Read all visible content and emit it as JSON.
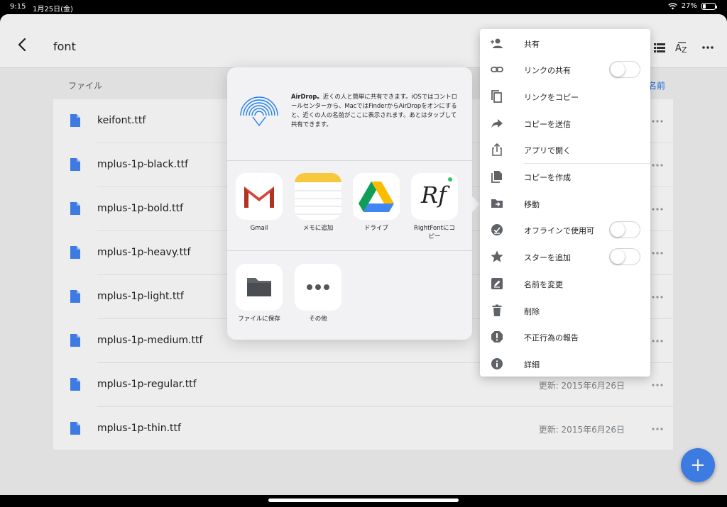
{
  "status": {
    "time": "9:15",
    "date": "1月25日(金)",
    "battery_pct": "27%",
    "battery_level": 0.27
  },
  "appbar": {
    "title": "font"
  },
  "list": {
    "header": "ファイル",
    "sort_label": "名前",
    "files": [
      {
        "name": "keifont.ttf",
        "date": ""
      },
      {
        "name": "mplus-1p-black.ttf",
        "date": ""
      },
      {
        "name": "mplus-1p-bold.ttf",
        "date": ""
      },
      {
        "name": "mplus-1p-heavy.ttf",
        "date": ""
      },
      {
        "name": "mplus-1p-light.ttf",
        "date": ""
      },
      {
        "name": "mplus-1p-medium.ttf",
        "date": ""
      },
      {
        "name": "mplus-1p-regular.ttf",
        "date": "更新: 2015年6月26日"
      },
      {
        "name": "mplus-1p-thin.ttf",
        "date": "更新: 2015年6月26日"
      }
    ]
  },
  "share_sheet": {
    "airdrop_title": "AirDrop。",
    "airdrop_text": "近くの人と簡単に共有できます。iOSではコントロールセンターから、MacではFinderからAirDropをオンにすると、近くの人の名前がここに表示されます。あとはタップして共有できます。",
    "apps": [
      {
        "label": "Gmail",
        "icon": "gmail-icon"
      },
      {
        "label": "メモに追加",
        "icon": "notes-icon"
      },
      {
        "label": "ドライブ",
        "icon": "drive-icon"
      },
      {
        "label": "RightFontにコピー",
        "icon": "rightfont-icon",
        "icon_text": "Rf"
      }
    ],
    "actions": [
      {
        "label": "ファイルに保存",
        "icon": "folder-icon"
      },
      {
        "label": "その他",
        "icon": "more-icon"
      }
    ]
  },
  "menu": {
    "items": [
      {
        "label": "共有",
        "icon": "add-person-icon"
      },
      {
        "label": "リンクの共有",
        "icon": "link-icon",
        "toggle": true,
        "on": false
      },
      {
        "label": "リンクをコピー",
        "icon": "copy-icon"
      },
      {
        "label": "コピーを送信",
        "icon": "send-arrow-icon"
      },
      {
        "label": "アプリで開く",
        "icon": "open-in-icon"
      },
      {
        "label": "コピーを作成",
        "icon": "duplicate-icon"
      },
      {
        "label": "移動",
        "icon": "move-folder-icon"
      },
      {
        "label": "オフラインで使用可",
        "icon": "offline-icon",
        "toggle": true,
        "on": false
      },
      {
        "label": "スターを追加",
        "icon": "star-icon",
        "toggle": true,
        "on": false
      },
      {
        "label": "名前を変更",
        "icon": "rename-icon"
      },
      {
        "label": "削除",
        "icon": "trash-icon"
      },
      {
        "label": "不正行為の報告",
        "icon": "report-icon"
      },
      {
        "label": "詳細",
        "icon": "info-icon"
      }
    ]
  },
  "colors": {
    "accent": "#4285f4",
    "file_icon": "#4285f4",
    "menu_icon": "#5f6368",
    "gmail_red": "#d44638",
    "notes_yellow": "#f7c83b",
    "airdrop_blue": "#1f7ff1"
  }
}
